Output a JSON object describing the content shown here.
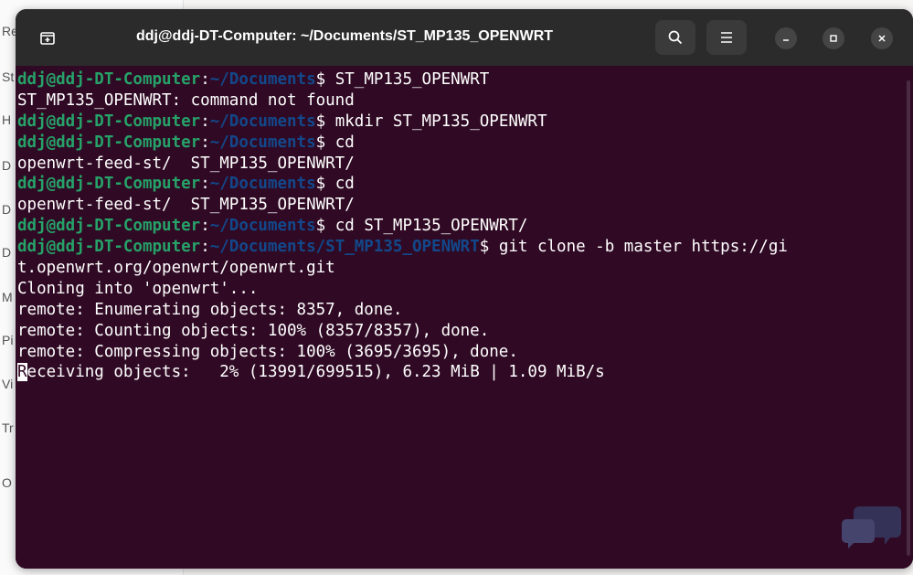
{
  "background": {
    "letters": [
      "Re",
      "St",
      "H",
      "D",
      "D",
      "D",
      "M",
      "Pi",
      "Vi",
      "Tr",
      "O"
    ]
  },
  "window": {
    "title": "ddj@ddj-DT-Computer: ~/Documents/ST_MP135_OPENWRT",
    "buttons": {
      "new_tab_icon": "new-tab-icon",
      "search_icon": "search-icon",
      "menu_icon": "hamburger-menu-icon",
      "minimize_icon": "minimize-icon",
      "maximize_icon": "maximize-icon",
      "close_icon": "close-icon"
    }
  },
  "terminal": {
    "colors": {
      "background": "#300a24",
      "user": "#26a269",
      "path": "#12488b",
      "text": "#ffffff"
    },
    "lines": [
      {
        "user": "ddj@ddj-DT-Computer",
        "colon": ":",
        "path": "~/Documents",
        "sym": "$ ",
        "text": "ST_MP135_OPENWRT"
      },
      {
        "text": "ST_MP135_OPENWRT: command not found"
      },
      {
        "user": "ddj@ddj-DT-Computer",
        "colon": ":",
        "path": "~/Documents",
        "sym": "$ ",
        "text": "mkdir ST_MP135_OPENWRT"
      },
      {
        "user": "ddj@ddj-DT-Computer",
        "colon": ":",
        "path": "~/Documents",
        "sym": "$ ",
        "text": "cd"
      },
      {
        "text": "openwrt-feed-st/  ST_MP135_OPENWRT/"
      },
      {
        "user": "ddj@ddj-DT-Computer",
        "colon": ":",
        "path": "~/Documents",
        "sym": "$ ",
        "text": "cd"
      },
      {
        "text": "openwrt-feed-st/  ST_MP135_OPENWRT/"
      },
      {
        "user": "ddj@ddj-DT-Computer",
        "colon": ":",
        "path": "~/Documents",
        "sym": "$ ",
        "text": "cd ST_MP135_OPENWRT/"
      },
      {
        "user": "ddj@ddj-DT-Computer",
        "colon": ":",
        "path": "~/Documents/ST_MP135_OPENWRT",
        "sym": "$ ",
        "text": "git clone -b master https://gi"
      },
      {
        "text": "t.openwrt.org/openwrt/openwrt.git"
      },
      {
        "text": "Cloning into 'openwrt'..."
      },
      {
        "text": "remote: Enumerating objects: 8357, done."
      },
      {
        "text": "remote: Counting objects: 100% (8357/8357), done."
      },
      {
        "text": "remote: Compressing objects: 100% (3695/3695), done."
      },
      {
        "cursor": "R",
        "text": "eceiving objects:   2% (13991/699515), 6.23 MiB | 1.09 MiB/s"
      }
    ]
  }
}
